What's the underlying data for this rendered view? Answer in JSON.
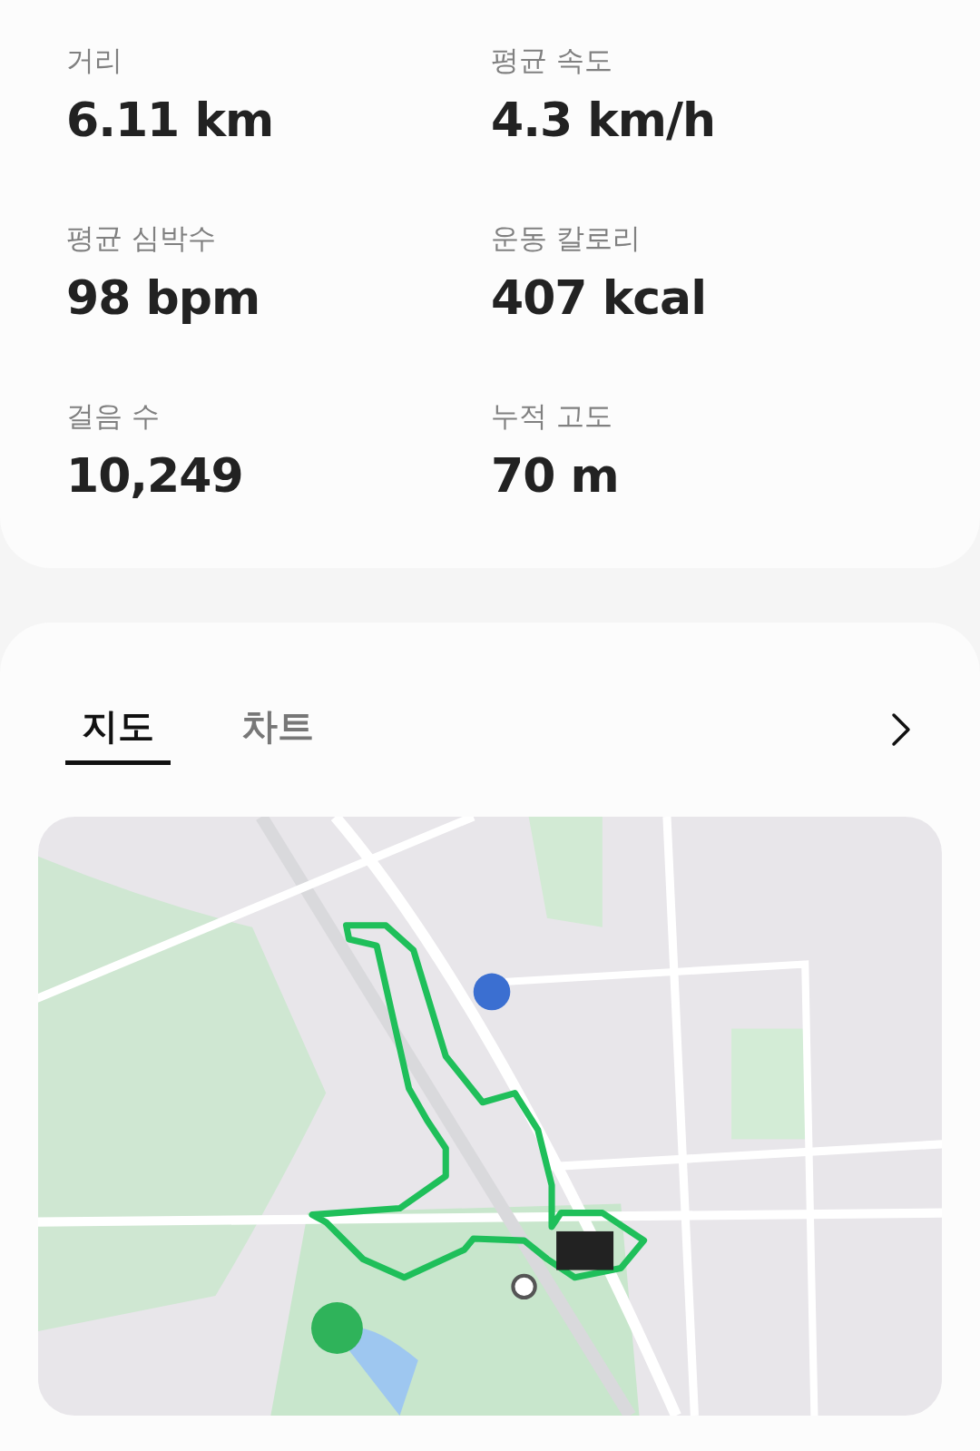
{
  "stats": [
    {
      "label": "거리",
      "value": "6.11 km"
    },
    {
      "label": "평균 속도",
      "value": "4.3 km/h"
    },
    {
      "label": "평균 심박수",
      "value": "98 bpm"
    },
    {
      "label": "운동 칼로리",
      "value": "407 kcal"
    },
    {
      "label": "걸음 수",
      "value": "10,249"
    },
    {
      "label": "누적 고도",
      "value": "70 m"
    }
  ],
  "tabs": [
    {
      "label": "지도",
      "selected": true
    },
    {
      "label": "차트",
      "selected": false
    }
  ]
}
